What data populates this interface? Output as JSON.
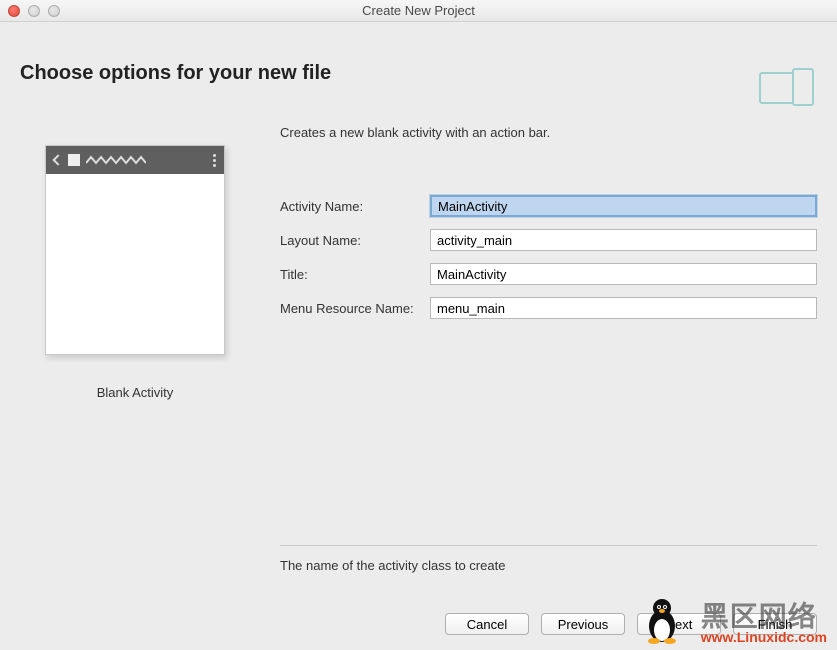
{
  "window": {
    "title": "Create New Project"
  },
  "header": {
    "title": "Choose options for your new file"
  },
  "form": {
    "description": "Creates a new blank activity with an action bar.",
    "fields": {
      "activity_name": {
        "label": "Activity Name:",
        "value": "MainActivity"
      },
      "layout_name": {
        "label": "Layout Name:",
        "value": "activity_main"
      },
      "title": {
        "label": "Title:",
        "value": "MainActivity"
      },
      "menu_resource_name": {
        "label": "Menu Resource Name:",
        "value": "menu_main"
      }
    },
    "hint": "The name of the activity class to create"
  },
  "preview": {
    "label": "Blank Activity"
  },
  "buttons": {
    "cancel": "Cancel",
    "previous": "Previous",
    "next": "Next",
    "finish": "Finish"
  },
  "watermark": {
    "text": "黑区网络",
    "url": "www.Linuxidc.com"
  }
}
